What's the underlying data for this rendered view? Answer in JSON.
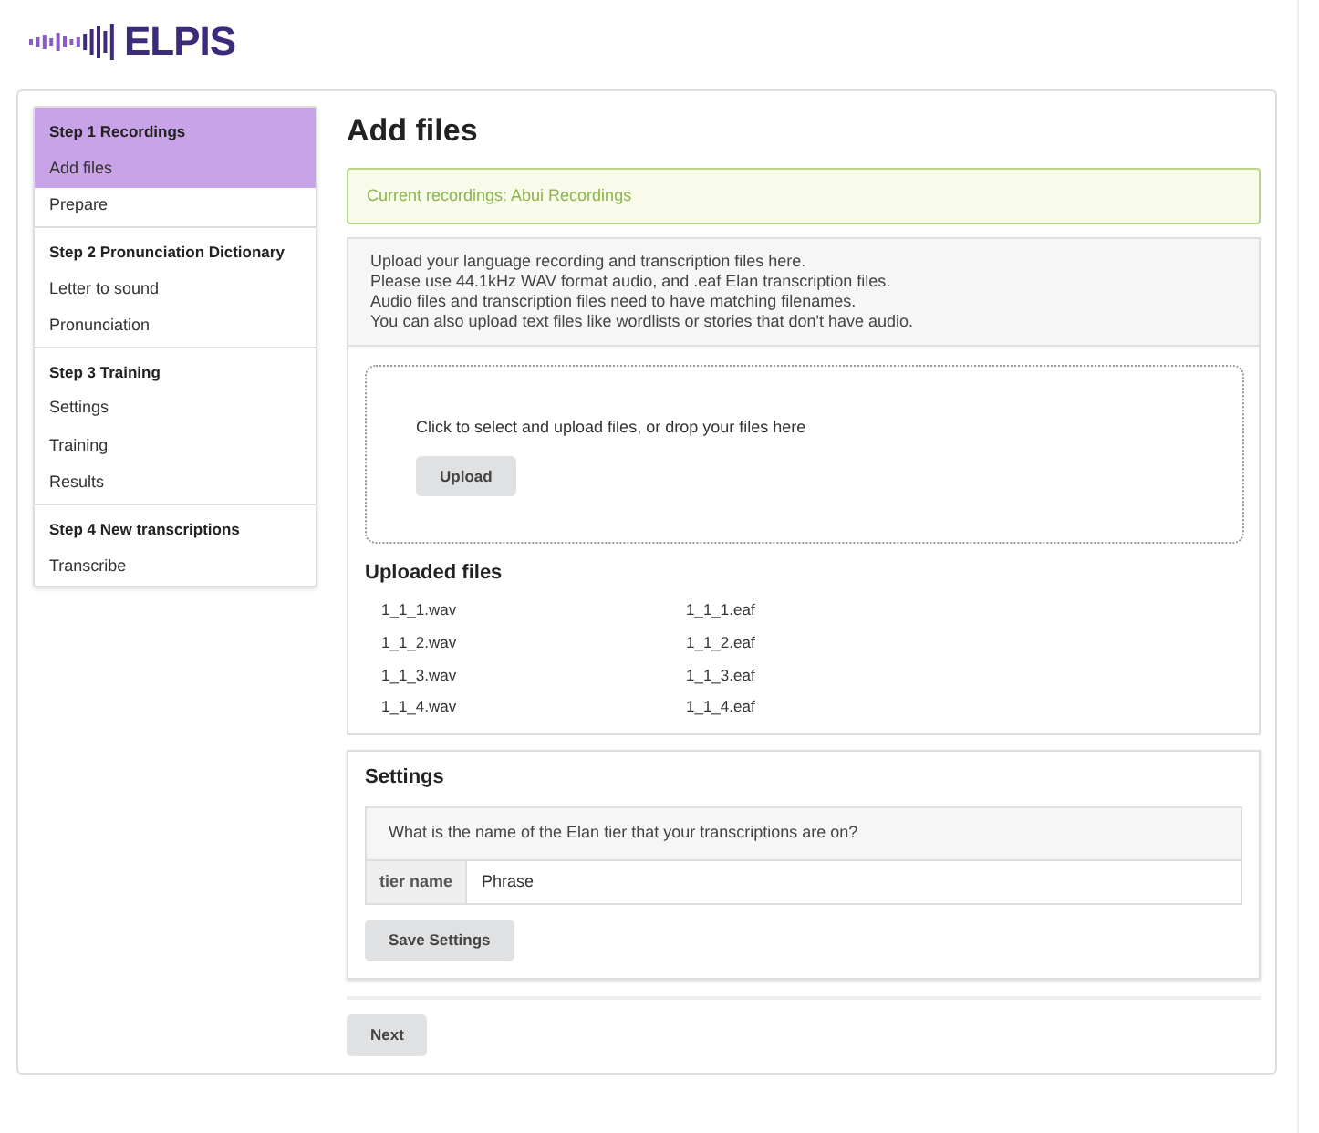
{
  "logo": {
    "text": "ELPIS"
  },
  "sidebar": {
    "groups": [
      {
        "heading": "Step 1 Recordings",
        "active": true,
        "items": [
          {
            "label": "Add files",
            "selected": true
          },
          {
            "label": "Prepare",
            "selected": false
          }
        ]
      },
      {
        "heading": "Step 2 Pronunciation Dictionary",
        "active": false,
        "items": [
          {
            "label": "Letter to sound",
            "selected": false
          },
          {
            "label": "Pronunciation",
            "selected": false
          }
        ]
      },
      {
        "heading": "Step 3 Training",
        "active": false,
        "items": [
          {
            "label": "Settings",
            "selected": false
          },
          {
            "label": "Training",
            "selected": false
          },
          {
            "label": "Results",
            "selected": false
          }
        ]
      },
      {
        "heading": "Step 4 New transcriptions",
        "active": false,
        "items": [
          {
            "label": "Transcribe",
            "selected": false
          }
        ]
      }
    ]
  },
  "page_title": "Add files",
  "alert": "Current recordings: Abui Recordings",
  "instructions": [
    "Upload your language recording and transcription files here.",
    "Please use 44.1kHz WAV format audio, and .eaf Elan transcription files.",
    "Audio files and transcription files need to have matching filenames.",
    "You can also upload text files like wordlists or stories that don't have audio."
  ],
  "dropzone": {
    "text": "Click to select and upload files, or drop your files here",
    "button": "Upload"
  },
  "uploaded": {
    "title": "Uploaded files",
    "columns": [
      [
        "1_1_1.wav",
        "1_1_2.wav",
        "1_1_3.wav",
        "1_1_4.wav"
      ],
      [
        "1_1_1.eaf",
        "1_1_2.eaf",
        "1_1_3.eaf",
        "1_1_4.eaf"
      ]
    ]
  },
  "settings": {
    "title": "Settings",
    "question": "What is the name of the Elan tier that your transcriptions are on?",
    "field_label": "tier name",
    "field_value": "Phrase",
    "button": "Save Settings"
  },
  "next_button": "Next"
}
